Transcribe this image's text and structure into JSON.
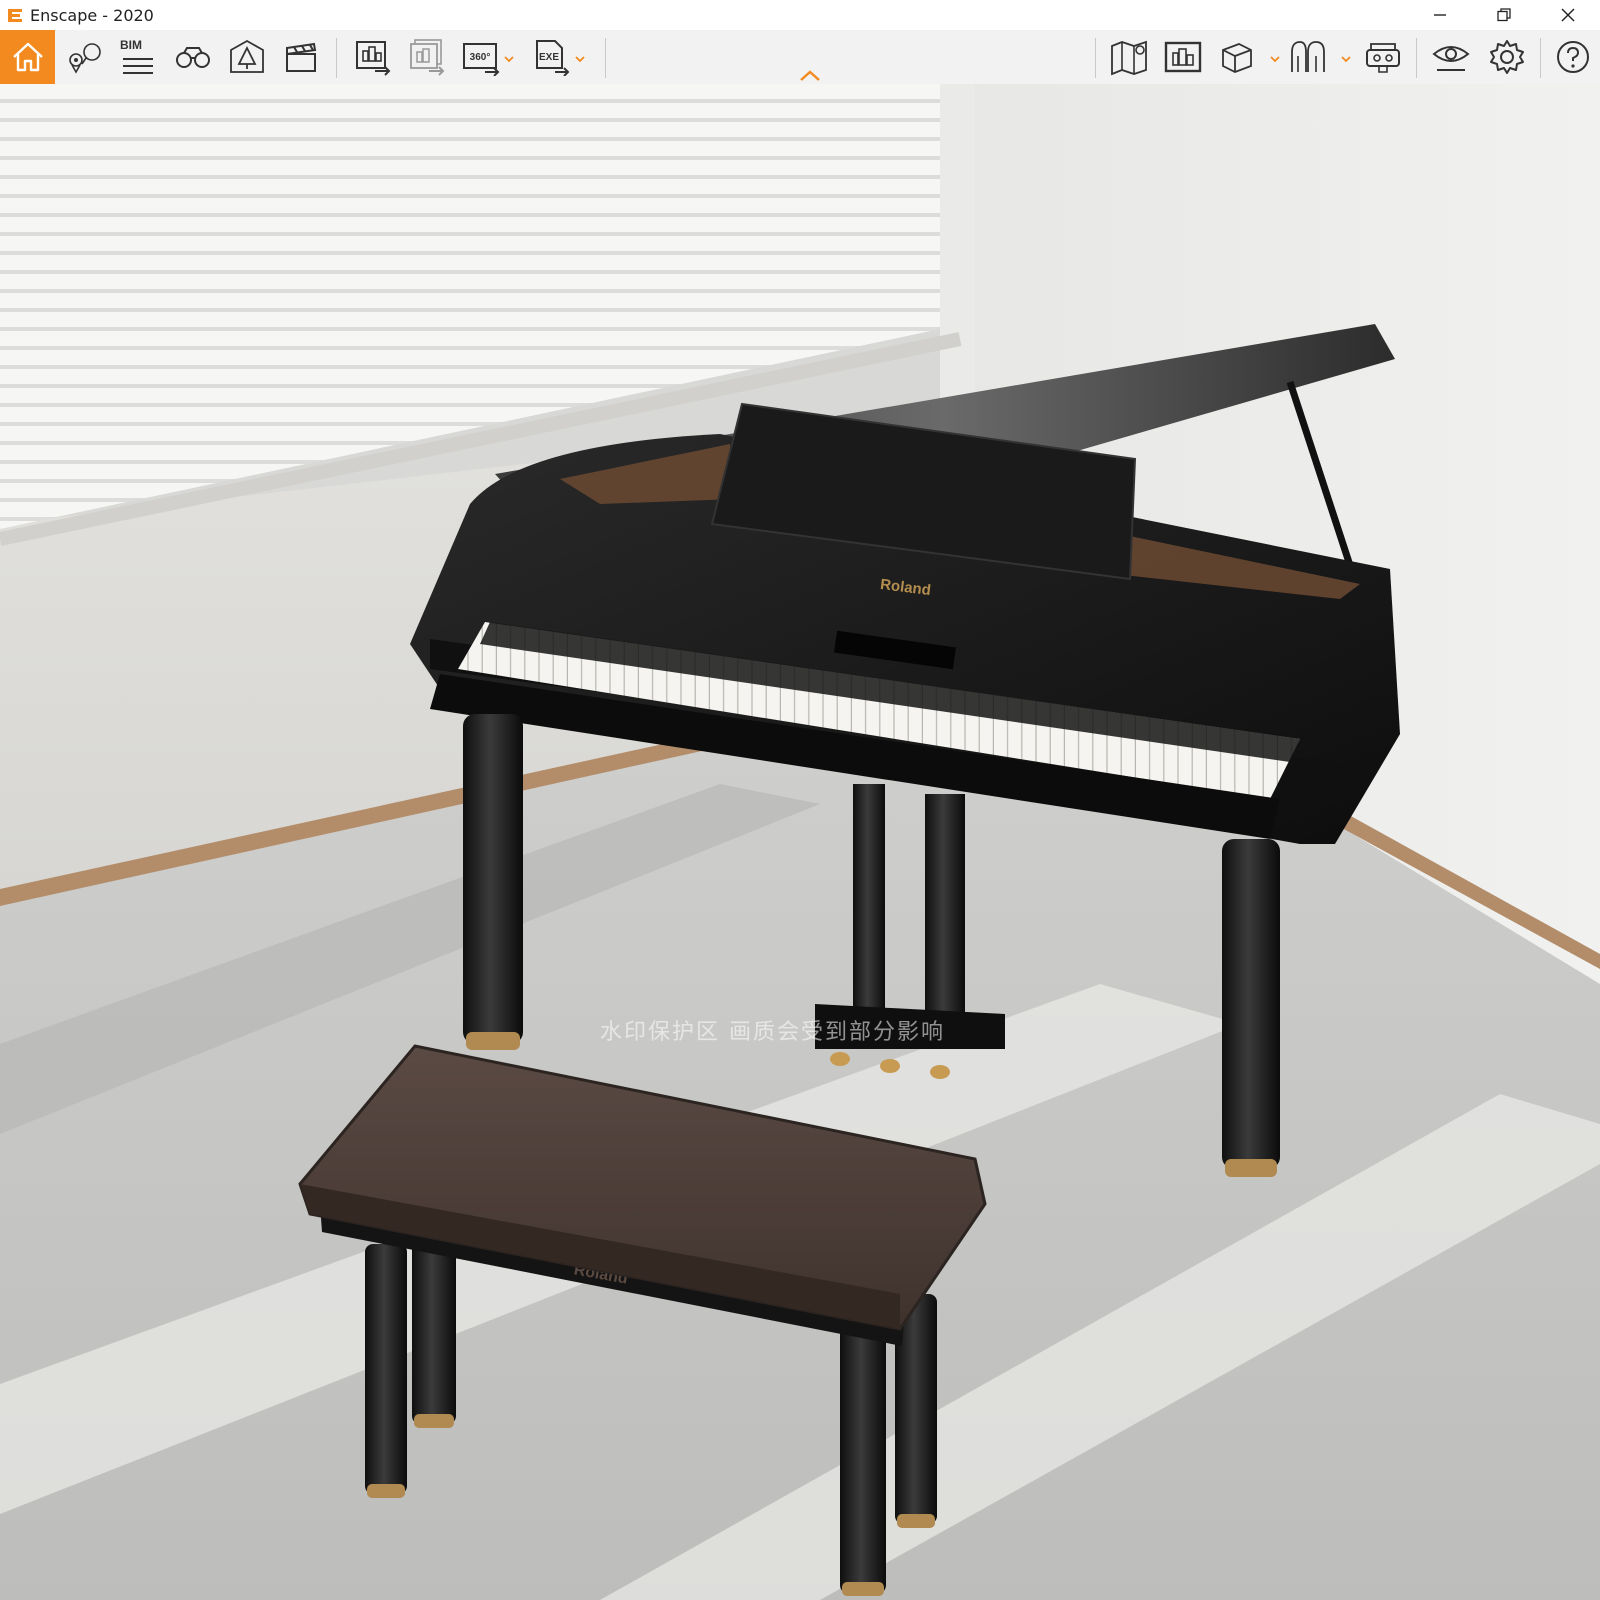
{
  "window": {
    "title": "Enscape - 2020"
  },
  "toolbar": {
    "bim_label": "BIM",
    "360_label": "360°",
    "exe_label": "EXE",
    "accent": "#f28a1f"
  },
  "viewport": {
    "piano_brand": "Roland",
    "bench_brand": "Roland",
    "watermark": "水印保护区 画质会受到部分影响"
  }
}
